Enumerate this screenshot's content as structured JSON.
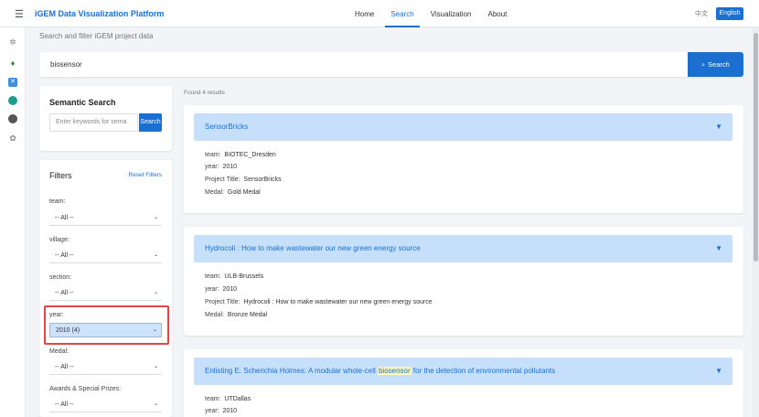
{
  "header": {
    "title": "iGEM Data Visualization Platform",
    "nav": [
      "Home",
      "Search",
      "Visualization",
      "About"
    ],
    "active_nav": "Search",
    "lang_zh": "中文",
    "lang_en": "English"
  },
  "rail_icons": [
    "gear-icon",
    "leaf-icon",
    "share-icon",
    "globe-icon",
    "user-icon",
    "settings-icon"
  ],
  "subtitle": "Search and filter iGEM project data",
  "search": {
    "value": "biosensor",
    "button": "Search",
    "icon": "⌕"
  },
  "semantic": {
    "title": "Semantic Search",
    "placeholder": "Enter keywords for sema",
    "button": "Search"
  },
  "filters": {
    "title": "Filters",
    "reset": "Reset Filters",
    "fields": [
      {
        "label": "team:",
        "value": "-- All --"
      },
      {
        "label": "village:",
        "value": "-- All --"
      },
      {
        "label": "section:",
        "value": "-- All --"
      },
      {
        "label": "year:",
        "value": "2010 (4)"
      },
      {
        "label": "Medal:",
        "value": "-- All --"
      },
      {
        "label": "Awards & Special Prizes:",
        "value": "-- All --"
      }
    ]
  },
  "found": "Found 4 results",
  "results": [
    {
      "title": "SensorBricks",
      "rows": [
        {
          "k": "team:",
          "v": "BIOTEC_Dresden"
        },
        {
          "k": "year:",
          "v": "2010"
        },
        {
          "k": "Project Title:",
          "v": "SensorBricks"
        },
        {
          "k": "Medal:",
          "v": "Gold Medal"
        }
      ]
    },
    {
      "title": "Hydrocoli : How to make wastewater our new green energy source",
      "rows": [
        {
          "k": "team:",
          "v": "ULB-Brussels"
        },
        {
          "k": "year:",
          "v": "2010"
        },
        {
          "k": "Project Title:",
          "v": "Hydrocoli : How to make wastewater our new green energy source"
        },
        {
          "k": "Medal:",
          "v": "Bronze Medal"
        }
      ]
    },
    {
      "title_before": "Enlisting E. Scherichia Holmes: A modular whole-cell",
      "title_highlight": "biosensor",
      "title_after": "for the detection of environmental pollutants",
      "rows": [
        {
          "k": "team:",
          "v": "UTDallas"
        },
        {
          "k": "year:",
          "v": "2010"
        }
      ]
    }
  ]
}
